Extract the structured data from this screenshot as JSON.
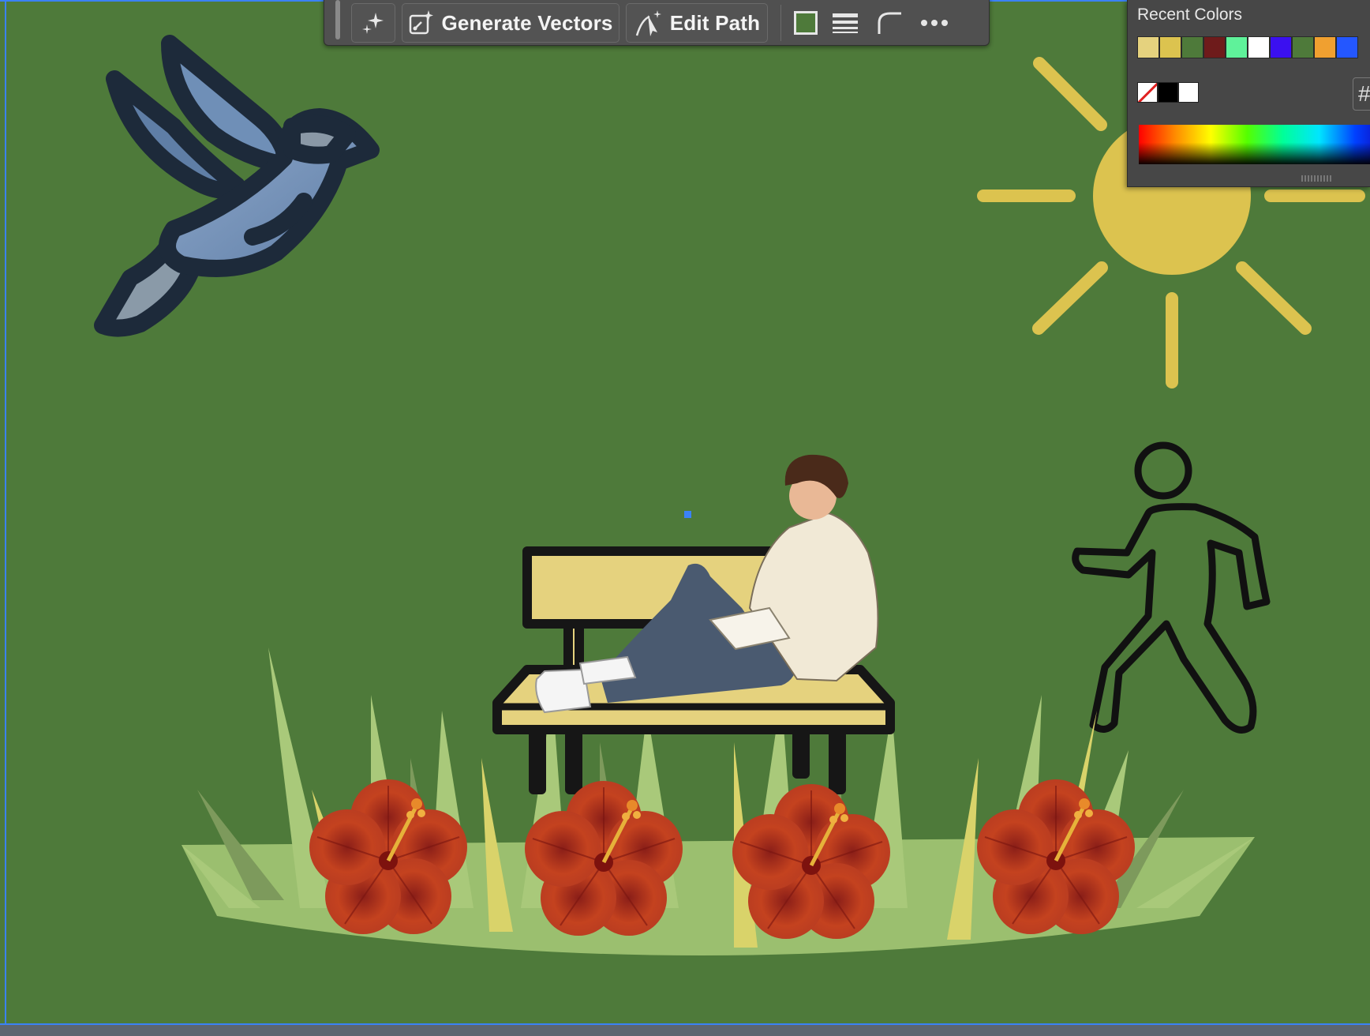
{
  "taskbar": {
    "generate_vectors_label": "Generate Vectors",
    "edit_path_label": "Edit Path",
    "fill_swatch_color": "#4e7a3a",
    "icons": [
      "grip-handle-icon",
      "sparkle-icon",
      "generate-vectors-icon",
      "edit-path-icon",
      "fill-swatch-icon",
      "stroke-lines-icon",
      "corner-icon",
      "more-icon"
    ]
  },
  "recent_colors_panel": {
    "title": "Recent Colors",
    "swatches": [
      "#e5d27e",
      "#dcc34f",
      "#4e7a3a",
      "#6e1b1b",
      "#5ff29a",
      "#ffffff",
      "#3b10f0",
      "#4e7a3a",
      "#f0a030",
      "#2457ff"
    ],
    "fill_stroke": [
      "none",
      "#000000",
      "#ffffff"
    ],
    "hex_prefix": "#"
  },
  "canvas": {
    "background": "#4e7a3a",
    "objects": [
      "bird-illustration",
      "sun-illustration",
      "walking-person-icon",
      "park-bench",
      "person-reading-illustration",
      "grass-patch",
      "hibiscus-flowers"
    ]
  }
}
